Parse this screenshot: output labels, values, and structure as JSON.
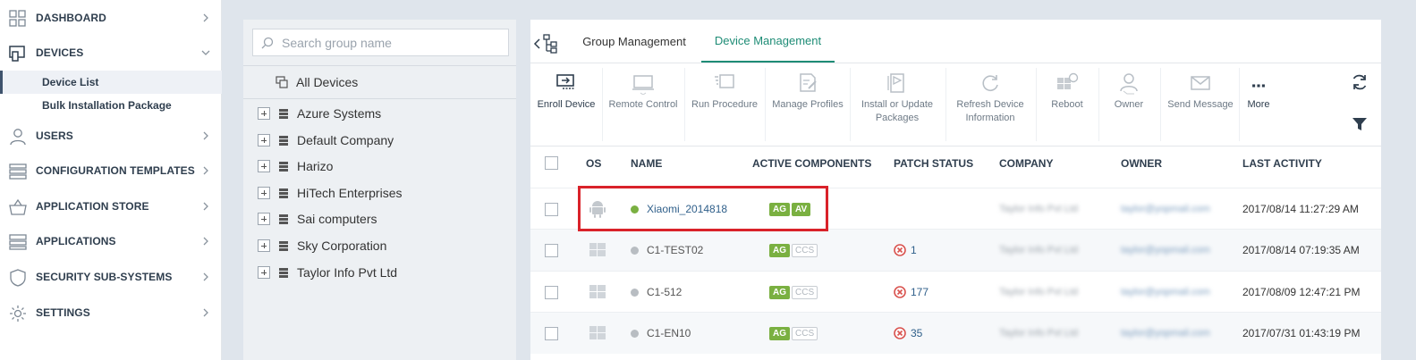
{
  "sidebar": {
    "items": [
      {
        "label": "DASHBOARD",
        "icon": "dashboard-icon"
      },
      {
        "label": "DEVICES",
        "icon": "devices-icon"
      },
      {
        "label": "USERS",
        "icon": "users-icon"
      },
      {
        "label": "CONFIGURATION TEMPLATES",
        "icon": "config-templates-icon"
      },
      {
        "label": "APPLICATION STORE",
        "icon": "app-store-icon"
      },
      {
        "label": "APPLICATIONS",
        "icon": "applications-icon"
      },
      {
        "label": "SECURITY SUB-SYSTEMS",
        "icon": "shield-icon"
      },
      {
        "label": "SETTINGS",
        "icon": "gear-icon"
      }
    ],
    "devices_sub": [
      "Device List",
      "Bulk Installation Package"
    ]
  },
  "groups": {
    "search_placeholder": "Search group name",
    "all_devices": "All Devices",
    "items": [
      "Azure Systems",
      "Default Company",
      "Harizo",
      "HiTech Enterprises",
      "Sai computers",
      "Sky Corporation",
      "Taylor Info Pvt Ltd"
    ]
  },
  "tabs": [
    "Group Management",
    "Device Management"
  ],
  "toolbar": {
    "enroll": "Enroll Device",
    "remote": "Remote Control",
    "run": "Run Procedure",
    "profiles": "Manage Profiles",
    "install_1": "Install or Update",
    "install_2": "Packages",
    "refresh_1": "Refresh Device",
    "refresh_2": "Information",
    "reboot": "Reboot",
    "owner": "Owner",
    "send": "Send Message",
    "more": "More"
  },
  "table": {
    "headers": [
      "OS",
      "NAME",
      "ACTIVE COMPONENTS",
      "PATCH STATUS",
      "COMPANY",
      "OWNER",
      "LAST ACTIVITY"
    ],
    "rows": [
      {
        "os": "android",
        "status": "online",
        "name": "Xiaomi_2014818",
        "components": [
          {
            "label": "AG",
            "active": true
          },
          {
            "label": "AV",
            "active": true
          }
        ],
        "patch": "",
        "company": "Taylor Info Pvt Ltd",
        "owner": "taylor@yopmail.com",
        "last_activity": "2017/08/14 11:27:29 AM"
      },
      {
        "os": "windows",
        "status": "offline",
        "name": "C1-TEST02",
        "components": [
          {
            "label": "AG",
            "active": true
          },
          {
            "label": "CCS",
            "active": false
          }
        ],
        "patch": "1",
        "company": "Taylor Info Pvt Ltd",
        "owner": "taylor@yopmail.com",
        "last_activity": "2017/08/14 07:19:35 AM"
      },
      {
        "os": "windows",
        "status": "offline",
        "name": "C1-512",
        "components": [
          {
            "label": "AG",
            "active": true
          },
          {
            "label": "CCS",
            "active": false
          }
        ],
        "patch": "177",
        "company": "Taylor Info Pvt Ltd",
        "owner": "taylor@yopmail.com",
        "last_activity": "2017/08/09 12:47:21 PM"
      },
      {
        "os": "windows",
        "status": "offline",
        "name": "C1-EN10",
        "components": [
          {
            "label": "AG",
            "active": true
          },
          {
            "label": "CCS",
            "active": false
          }
        ],
        "patch": "35",
        "company": "Taylor Info Pvt Ltd",
        "owner": "taylor@yopmail.com",
        "last_activity": "2017/07/31 01:43:19 PM"
      }
    ]
  },
  "colors": {
    "accent": "#1e8c76",
    "online": "#7ab041",
    "offline": "#b8bdc2",
    "highlight": "#d9222a",
    "error": "#d9534f"
  }
}
